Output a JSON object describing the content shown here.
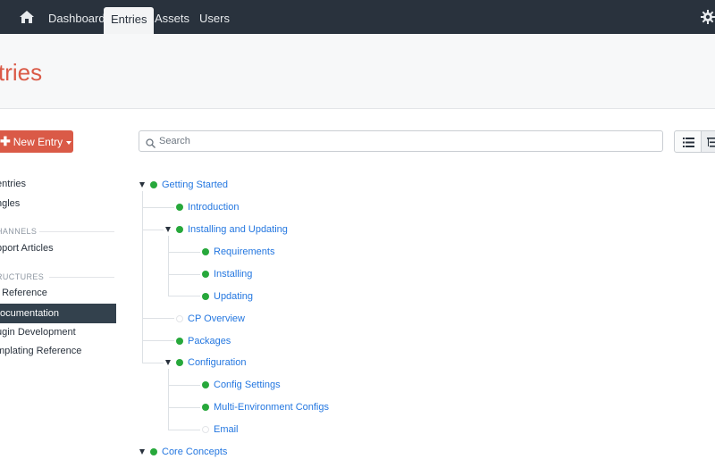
{
  "nav": {
    "home_icon": "home-icon",
    "items": [
      "Dashboard",
      "Entries",
      "Assets",
      "Users"
    ],
    "active": "Entries",
    "settings_icon": "gear-icon"
  },
  "header": {
    "title": "tries"
  },
  "sidebar": {
    "new_entry_label": "New Entry",
    "links_top": [
      "entries",
      "ngles"
    ],
    "channels_heading": "HANNELS",
    "channels": [
      "pport Articles"
    ],
    "structures_heading": "RUCTURES",
    "structures": [
      "I Reference",
      "ocumentation",
      "ugin Development",
      "mplating Reference"
    ],
    "active_item": "ocumentation"
  },
  "search": {
    "placeholder": "Search",
    "value": ""
  },
  "views": [
    "list-view-icon",
    "structure-view-icon"
  ],
  "tree": [
    {
      "label": "Getting Started",
      "status": "live",
      "expanded": true
    },
    {
      "label": "Introduction",
      "status": "live"
    },
    {
      "label": "Installing and Updating",
      "status": "live",
      "expanded": true
    },
    {
      "label": "Requirements",
      "status": "live"
    },
    {
      "label": "Installing",
      "status": "live"
    },
    {
      "label": "Updating",
      "status": "live"
    },
    {
      "label": "CP Overview",
      "status": "disabled"
    },
    {
      "label": "Packages",
      "status": "live"
    },
    {
      "label": "Configuration",
      "status": "live",
      "expanded": true
    },
    {
      "label": "Config Settings",
      "status": "live"
    },
    {
      "label": "Multi-Environment Configs",
      "status": "live"
    },
    {
      "label": "Email",
      "status": "disabled"
    },
    {
      "label": "Core Concepts",
      "status": "live",
      "expanded": true
    }
  ],
  "colors": {
    "topbar": "#29323d",
    "accent": "#da5a47",
    "link": "#2477e0",
    "live": "#27a83b",
    "sidebar_active": "#33414d"
  }
}
